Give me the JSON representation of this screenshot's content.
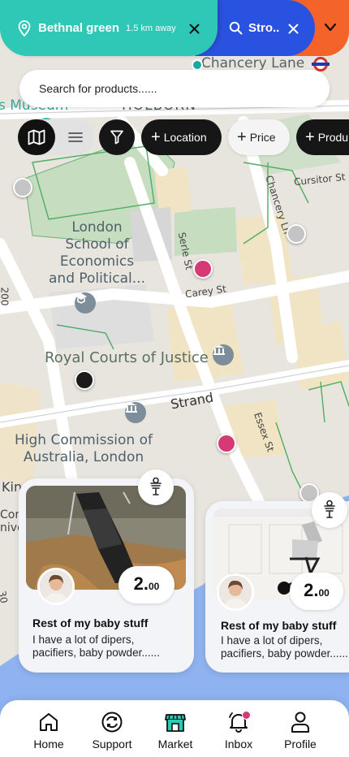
{
  "map": {
    "labels": {
      "chancery_lane": "Chancery Lane",
      "museum": "s Museum",
      "holborn": "HOLBORN",
      "lse": [
        "London",
        "School of",
        "Economics",
        "and Political..."
      ],
      "serle_st": "Serle St",
      "chancery_ln": "Chancery Ln",
      "cursitor_st": "Cursitor St",
      "carey_st": "Carey St",
      "royal_courts": "Royal Courts of Justice",
      "strand": "Strand",
      "essex_st": "Essex St",
      "high_commission": [
        "High Commission of",
        "Australia, London"
      ],
      "king": "Kin",
      "conve": [
        "Con",
        "nive"
      ],
      "left_200": "200",
      "left_30": "30"
    },
    "pin_colors": {
      "grey": "#c4c4c4",
      "pink": "#d63a74",
      "black": "#1b1b1b"
    }
  },
  "location_chips": {
    "primary": {
      "name": "Bethnal green",
      "distance": "1.5 km away",
      "color": "#2fc8b6"
    },
    "secondary": {
      "name": "Stro..",
      "color": "#2a52e0"
    },
    "tertiary": {
      "color": "#f4632a"
    }
  },
  "search": {
    "placeholder": "Search for products......"
  },
  "filters": {
    "location_label": "Location",
    "price_label": "Price",
    "products_label": "Produ"
  },
  "cards": [
    {
      "title": "Rest of my baby stuff",
      "desc_line1": "I have a lot of dipers,",
      "desc_line2": "pacifiers, baby powder......",
      "price_int": "2.",
      "price_dec": "00"
    },
    {
      "title": "Rest of my baby stuff",
      "desc_line1": "I have a lot of dipers,",
      "desc_line2": "pacifiers, baby powder......",
      "price_int": "2.",
      "price_dec": "00"
    }
  ],
  "nav": {
    "home": "Home",
    "support": "Support",
    "market": "Market",
    "inbox": "Inbox",
    "profile": "Profile",
    "market_color": "#2fc8b6",
    "notif_color": "#d63a74"
  }
}
